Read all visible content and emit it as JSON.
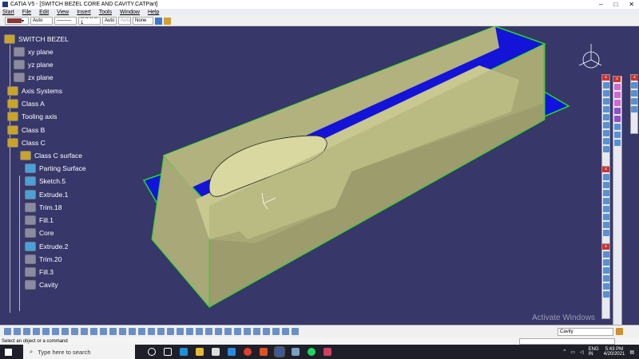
{
  "window": {
    "title": "CATIA V5 - [SWITCH BEZEL CORE AND CAVITY.CATPart]"
  },
  "menu": [
    "Start",
    "File",
    "Edit",
    "View",
    "Insert",
    "Tools",
    "Window",
    "Help"
  ],
  "toolbar": {
    "color": "#8b3a3a",
    "transparency": "Auto",
    "linetype": "———",
    "dash": "-- -- -- -- 1",
    "thickness": "Auto",
    "weight": "Auto",
    "layer": "None"
  },
  "tree": {
    "root": "SWITCH BEZEL",
    "items": [
      "xy plane",
      "yz plane",
      "zx plane",
      "Axis Systems",
      "Class A",
      "Tooling axis",
      "Class B",
      "Class C",
      "Class C surface",
      "Parting Surface",
      "Sketch.5",
      "Extrude.1",
      "Trim.18",
      "Fill.1",
      "Core",
      "Extrude.2",
      "Trim.20",
      "Fill.3",
      "Cavity"
    ]
  },
  "bottom": {
    "current_body": "Cavity"
  },
  "status": "Select an object or a command",
  "watermark": "Activate Windows",
  "taskbar": {
    "search": "Type here to search",
    "lang": "ENG",
    "region": "IN",
    "time": "5:43 PM",
    "date": "4/20/2021"
  },
  "colors": {
    "viewport": "#37376a",
    "solid": "#a9a97a",
    "parting": "#1010e0",
    "edge": "#22dd22"
  }
}
